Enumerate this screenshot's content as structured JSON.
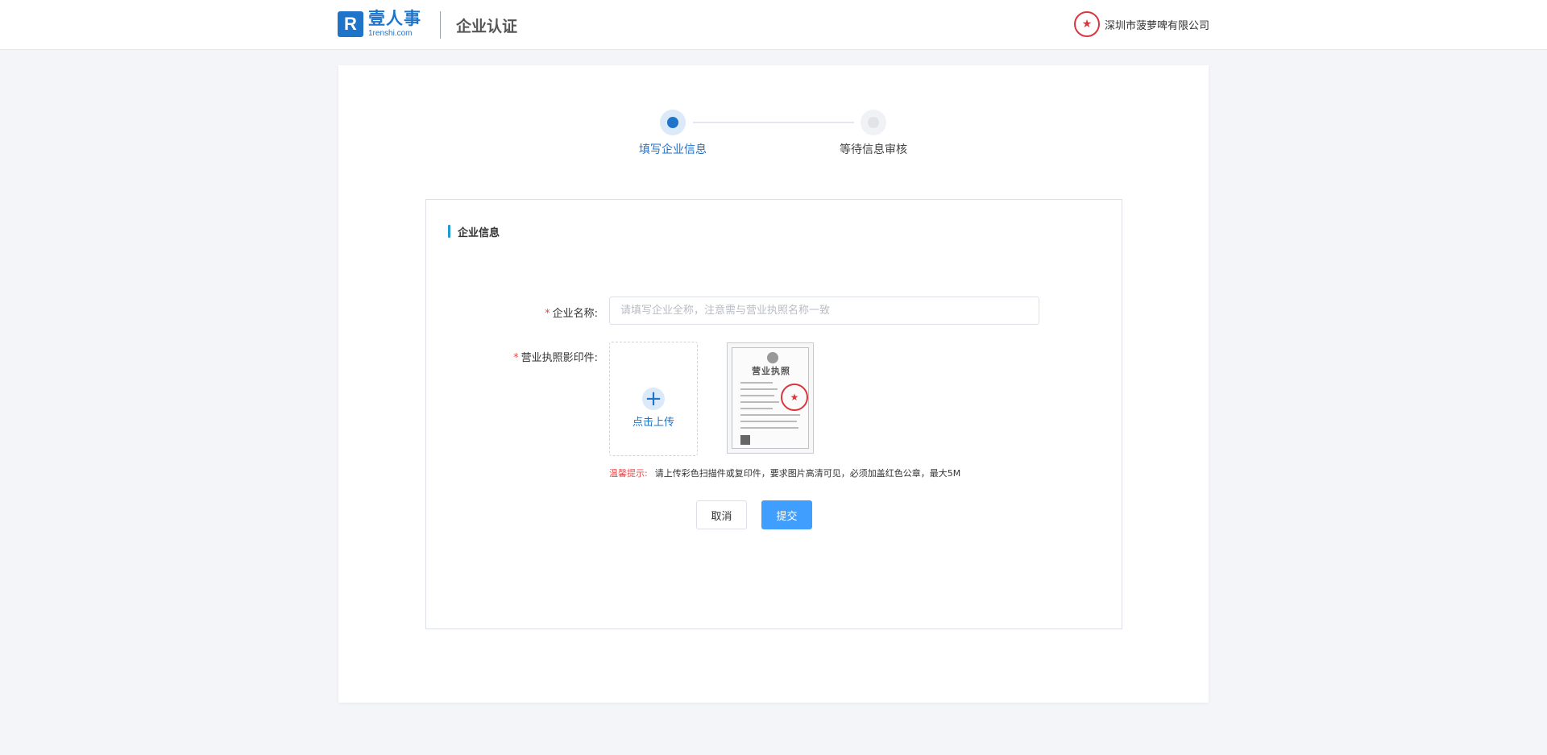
{
  "header": {
    "logo_cn": "壹人事",
    "logo_en": "1renshi.com",
    "logo_mark": "R",
    "title": "企业认证",
    "company_name": "深圳市菠萝啤有限公司"
  },
  "steps": [
    {
      "label": "填写企业信息",
      "state": "active"
    },
    {
      "label": "等待信息审核",
      "state": "pending"
    }
  ],
  "form": {
    "section_title": "企业信息",
    "required_mark": "*",
    "company_name_label": "企业名称:",
    "company_name_value": "",
    "company_name_placeholder": "请填写企业全称，注意需与营业执照名称一致",
    "license_label": "营业执照影印件:",
    "upload_text": "点击上传",
    "license_thumb_title": "营业执照",
    "hint_label": "温馨提示:",
    "hint_text": "请上传彩色扫描件或复印件，要求图片高清可见，必须加盖红色公章，最大5M",
    "cancel_label": "取消",
    "submit_label": "提交"
  },
  "colors": {
    "accent": "#1f73c9",
    "primary_button": "#409eff",
    "required": "#e84a4a",
    "background": "#f3f5f9"
  },
  "icons": {
    "logo": "logo-icon",
    "company_seal": "seal-icon",
    "upload": "plus-icon"
  }
}
